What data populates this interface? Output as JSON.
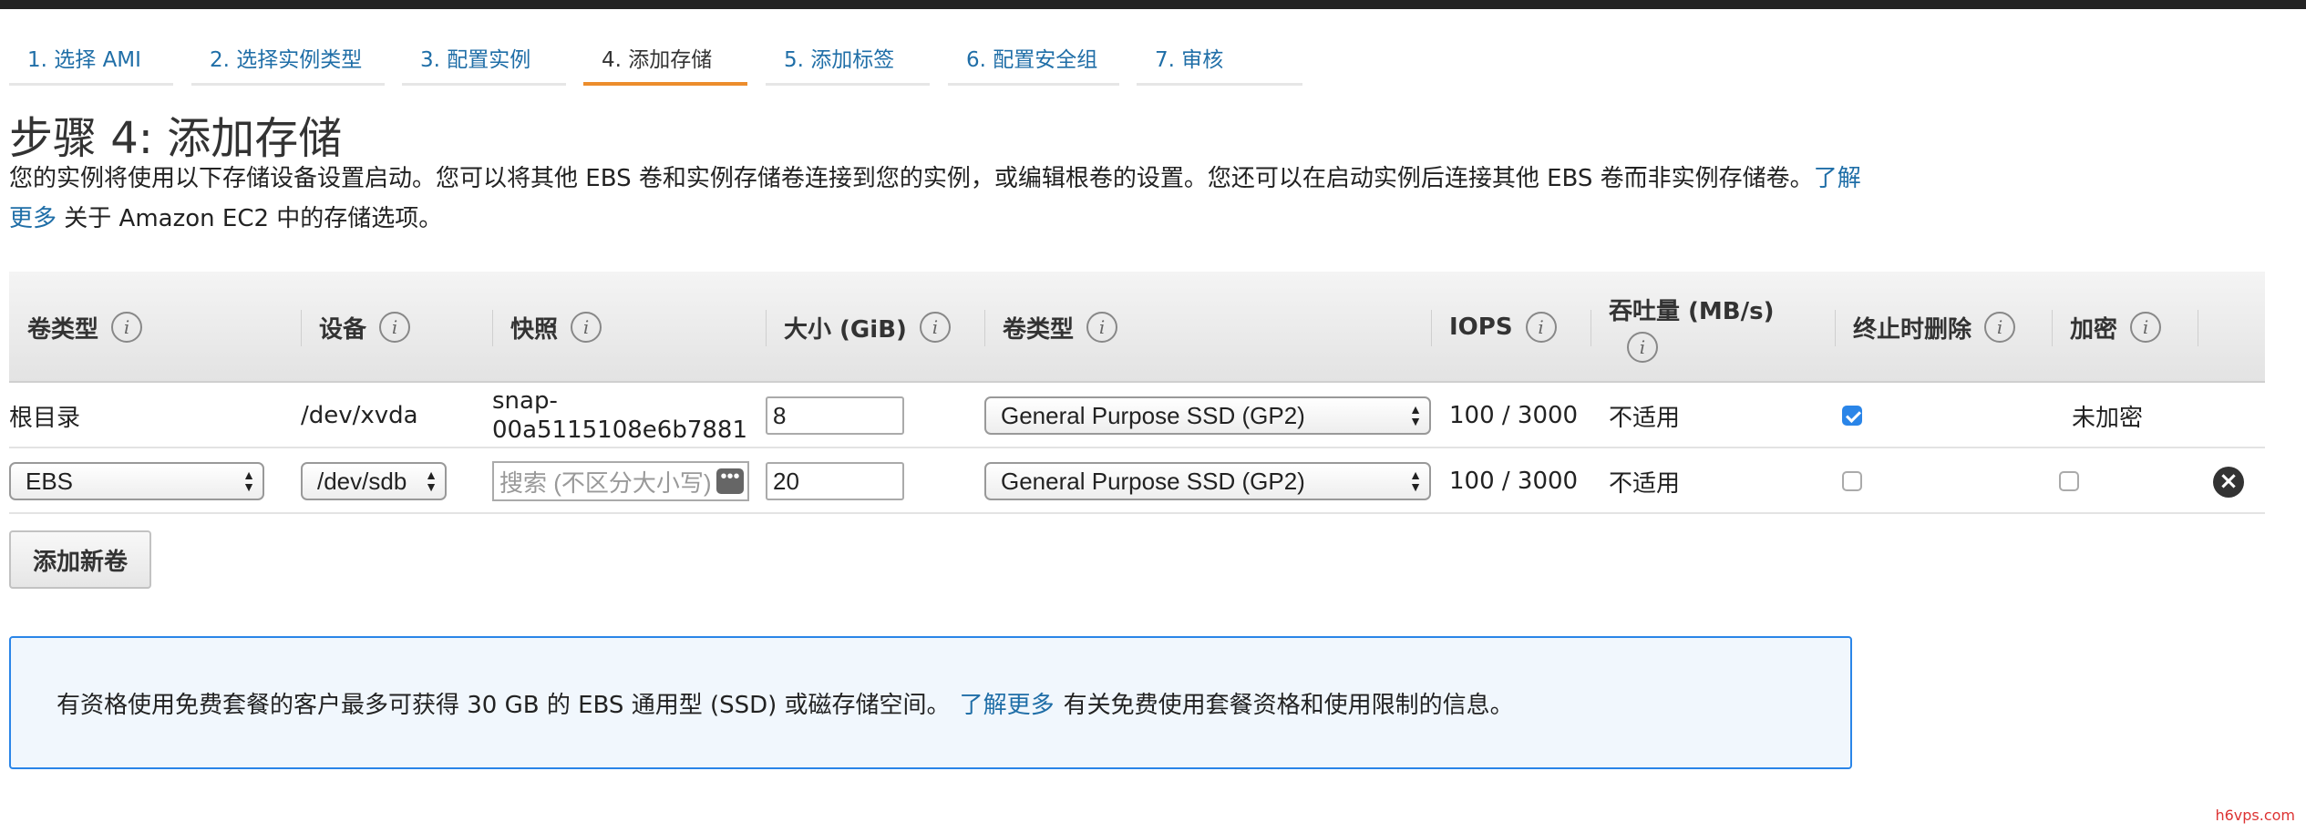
{
  "tabs": [
    {
      "label": "1. 选择 AMI",
      "active": false
    },
    {
      "label": "2. 选择实例类型",
      "active": false
    },
    {
      "label": "3. 配置实例",
      "active": false
    },
    {
      "label": "4. 添加存储",
      "active": true
    },
    {
      "label": "5. 添加标签",
      "active": false
    },
    {
      "label": "6. 配置安全组",
      "active": false
    },
    {
      "label": "7. 审核",
      "active": false
    }
  ],
  "page": {
    "title": "步骤 4: 添加存储",
    "description_before": "您的实例将使用以下存储设备设置启动。您可以将其他 EBS 卷和实例存储卷连接到您的实例，或编辑根卷的设置。您还可以在启动实例后连接其他 EBS 卷而非实例存储卷。",
    "learn_more": "了解更多",
    "description_after": " 关于 Amazon EC2 中的存储选项。"
  },
  "table": {
    "headers": {
      "volume_category": "卷类型",
      "device": "设备",
      "snapshot": "快照",
      "size": "大小 (GiB)",
      "volume_type": "卷类型",
      "iops": "IOPS",
      "throughput": "吞吐量 (MB/s)",
      "delete_on_termination": "终止时删除",
      "encryption": "加密"
    },
    "rows": [
      {
        "volume_category": "根目录",
        "device": "/dev/xvda",
        "snapshot_line1": "snap-",
        "snapshot_line2": "00a5115108e6b7881",
        "size": "8",
        "volume_type": "General Purpose SSD (GP2)",
        "iops": "100 / 3000",
        "throughput": "不适用",
        "delete_on_termination": true,
        "encryption": "未加密"
      },
      {
        "volume_category": "EBS",
        "device": "/dev/sdb",
        "snapshot_placeholder": "搜索 (不区分大小写)",
        "size": "20",
        "volume_type": "General Purpose SSD (GP2)",
        "iops": "100 / 3000",
        "throughput": "不适用",
        "delete_on_termination": false,
        "encrypted": false
      }
    ]
  },
  "add_volume_label": "添加新卷",
  "alert": {
    "text_before": "有资格使用免费套餐的客户最多可获得 30 GB 的 EBS 通用型 (SSD) 或磁存储空间。",
    "learn_more": "了解更多",
    "text_after": "有关免费使用套餐资格和使用限制的信息。"
  },
  "watermark": "h6vps.com",
  "icons": {
    "info": "info-icon",
    "remove": "remove-icon",
    "select_arrows": "select-arrows-icon",
    "more": "more-dots-icon"
  },
  "colors": {
    "link": "#1f6ea7",
    "active_tab": "#ec8d2c",
    "alert_border": "#2a85e8",
    "checkbox_checked": "#2a85e8"
  }
}
